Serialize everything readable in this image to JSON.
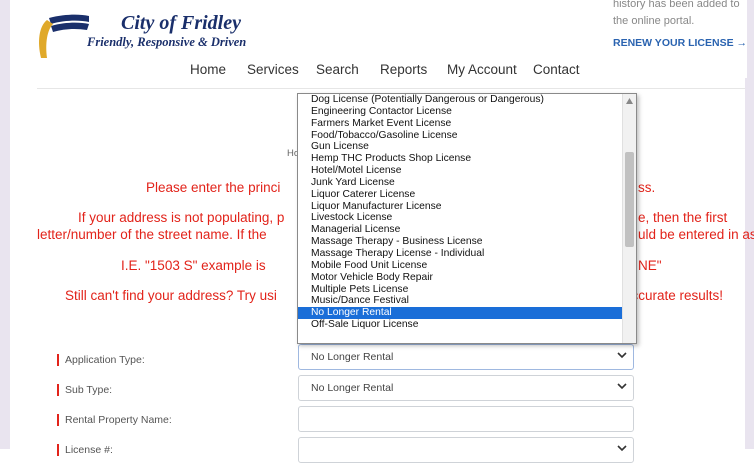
{
  "header": {
    "logo_title": "City of Fridley",
    "logo_subtitle": "Friendly, Responsive & Driven",
    "nav": [
      "Home",
      "Services",
      "Search",
      "Reports",
      "My Account",
      "Contact"
    ]
  },
  "promo": {
    "text": "history has been added to the online portal.",
    "link": "RENEW YOUR LICENSE →"
  },
  "breadcrumb_fragment": "Ho",
  "instructions": {
    "line1_left": "Please enter the princi",
    "line1_right": "ss.",
    "line2_left": "If your address is not populating, p",
    "line2_right": "e, then the first",
    "line3_left": "letter/number of the street name. If the",
    "line3_right": "uld be entered in as",
    "line4_left": "I.E. \"1503 S\" example is",
    "line4_right": "NE\"",
    "line5_left": "Still can't find your address? Try usi",
    "line5_right": "accurate results!"
  },
  "form": {
    "fields": [
      {
        "label": "Application Type:",
        "value": "No Longer Rental"
      },
      {
        "label": "Sub Type:",
        "value": "No Longer Rental"
      },
      {
        "label": "Rental Property Name:",
        "value": ""
      },
      {
        "label": "License #:",
        "value": ""
      }
    ]
  },
  "dropdown": {
    "options": [
      "Dog License (Potentially Dangerous or Dangerous)",
      "Engineering Contactor License",
      "Farmers Market Event License",
      "Food/Tobacco/Gasoline License",
      "Gun License",
      "Hemp THC Products Shop License",
      "Hotel/Motel License",
      "Junk Yard License",
      "Liquor Caterer License",
      "Liquor Manufacturer License",
      "Livestock License",
      "Managerial License",
      "Massage Therapy - Business License",
      "Massage Therapy License - Individual",
      "Mobile Food Unit License",
      "Motor Vehicle Body Repair",
      "Multiple Pets License",
      "Music/Dance Festival",
      "No Longer Rental",
      "Off-Sale Liquor License"
    ],
    "selected": "No Longer Rental"
  },
  "colors": {
    "brand_navy": "#1a2f6b",
    "brand_gold": "#e0a92a",
    "alert_red": "#e2231a",
    "link_blue": "#2a63b0",
    "selection_blue": "#1a6ed8"
  }
}
